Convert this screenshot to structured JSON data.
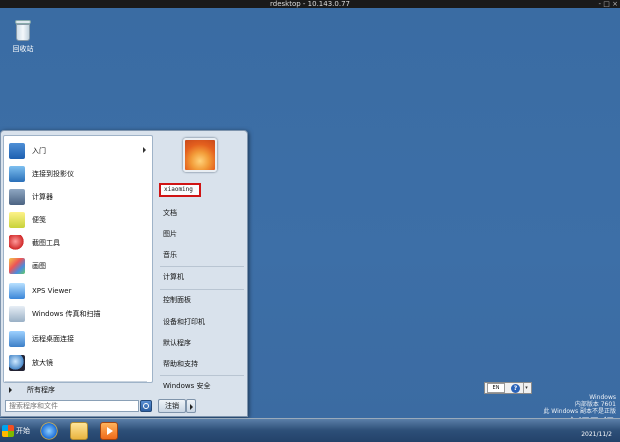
{
  "window": {
    "title": "rdesktop - 10.143.0.77",
    "buttons": "- □ ×"
  },
  "desktop": {
    "icons": [
      {
        "label": "回收站",
        "icon": "recycle-bin-icon"
      }
    ]
  },
  "start_menu": {
    "left_items": [
      {
        "label": "入门",
        "icon": "getting-started-icon",
        "has_submenu": true
      },
      {
        "label": "连接到投影仪",
        "icon": "projector-icon"
      },
      {
        "label": "计算器",
        "icon": "calculator-icon"
      },
      {
        "label": "便笺",
        "icon": "sticky-notes-icon"
      },
      {
        "label": "截图工具",
        "icon": "snipping-tool-icon"
      },
      {
        "label": "画图",
        "icon": "paint-icon"
      },
      {
        "label": "XPS Viewer",
        "icon": "xps-viewer-icon"
      },
      {
        "label": "Windows 传真和扫描",
        "icon": "fax-scan-icon"
      },
      {
        "label": "远程桌面连接",
        "icon": "remote-desktop-icon"
      },
      {
        "label": "放大镜",
        "icon": "magnifier-icon"
      }
    ],
    "all_programs": "所有程序",
    "search_placeholder": "搜索程序和文件",
    "user_name": "xiaoming",
    "right_items": [
      {
        "label": "文档"
      },
      {
        "label": "图片"
      },
      {
        "label": "音乐"
      },
      {
        "label": "计算机"
      },
      {
        "label": "控制面板"
      },
      {
        "label": "设备和打印机"
      },
      {
        "label": "默认程序"
      },
      {
        "label": "帮助和支持"
      },
      {
        "label": "Windows 安全"
      }
    ],
    "shutdown_label": "注销"
  },
  "language_bar": {
    "code": "EN",
    "help": "?"
  },
  "watermark": {
    "line1": "Windows",
    "line2": "内部版本 7601",
    "line3": "此 Windows 副本不是正版"
  },
  "csdn": "CSDN @夜间飞行",
  "taskbar": {
    "start_label": "开始",
    "clock": "2021/11/2"
  },
  "colors": {
    "desktop": "#3b6ea5",
    "highlight_border": "#d01414"
  }
}
